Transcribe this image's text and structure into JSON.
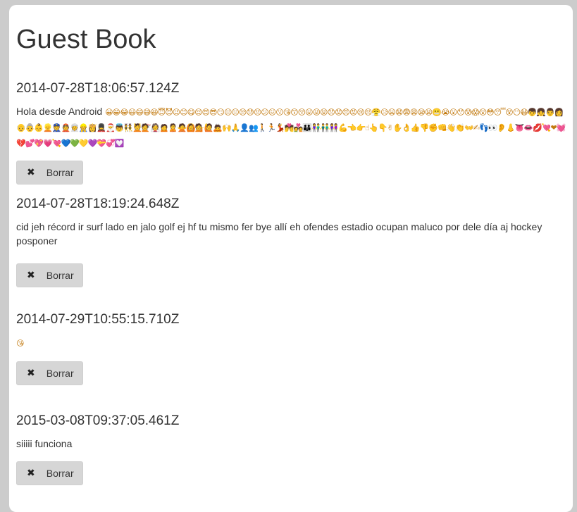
{
  "page": {
    "title": "Guest Book"
  },
  "entries": [
    {
      "timestamp": "2014-07-28T18:06:57.124Z",
      "message": "Hola desde Android",
      "emoji": "😀😁😂😃😄😅😆😇😈😉😊😋😌😍😎😏😐😑😒😓😔😕😖😗😘😙😚😛😜😝😞😟😠😡😢😣😤😥😦😧😨😩😪😫😬😭😮😯😰😱😲😳😴😵😶😷👦👧👨👩👴👵👶👱👮👲👳👷👸💂🎅👼👯💆💇👰🙍🙎🙅🙆💁🙋🙇🙌🙏👤👥🚶🏃💃💏💑👪👫👬👭💪👈👉☝👆👇✌✋👌👍👎✊👊👋👏👐✍👣👀👂👃👅👄💋💘❤💓💔💕💖💗💘💙💚💛💜💝💞💟",
      "delete_label": "Borrar"
    },
    {
      "timestamp": "2014-07-28T18:19:24.648Z",
      "message": "cid jeh récord ir surf lado en jalo golf ej hf tu mismo fer bye allí eh ofendes estadio ocupan maluco por dele día aj hockey posponer",
      "emoji": "",
      "delete_label": "Borrar"
    },
    {
      "timestamp": "2014-07-29T10:55:15.710Z",
      "message": "",
      "emoji": "😘",
      "delete_label": "Borrar"
    },
    {
      "timestamp": "2015-03-08T09:37:05.461Z",
      "message": "siiiii funciona",
      "emoji": "",
      "delete_label": "Borrar"
    }
  ],
  "icons": {
    "delete_icon": "close-icon",
    "delete_glyph": "✖"
  },
  "colors": {
    "background": "#cccccc",
    "card": "#ffffff",
    "button": "#d6d6d6",
    "text": "#333333"
  }
}
